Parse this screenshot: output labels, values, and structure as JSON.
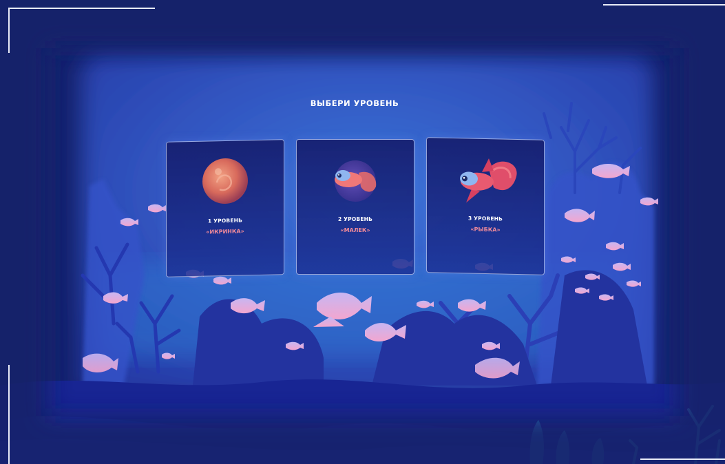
{
  "screen": {
    "title": "ВЫБЕРИ УРОВЕНЬ"
  },
  "levels": [
    {
      "number_label": "1 УРОВЕНЬ",
      "name": "«ИКРИНКА»",
      "icon": "fish-egg-icon"
    },
    {
      "number_label": "2 УРОВЕНЬ",
      "name": "«МАЛЕК»",
      "icon": "fry-fish-icon"
    },
    {
      "number_label": "3 УРОВЕНЬ",
      "name": "«РЫБКА»",
      "icon": "goldfish-icon"
    }
  ],
  "colors": {
    "background": "#12206a",
    "panel": "#2f4fc8",
    "seafloor": "#1a2a8a",
    "level_name": "#f08a9a",
    "fish_pink": "#e8a0c8",
    "coral": "#2a3ab0"
  }
}
